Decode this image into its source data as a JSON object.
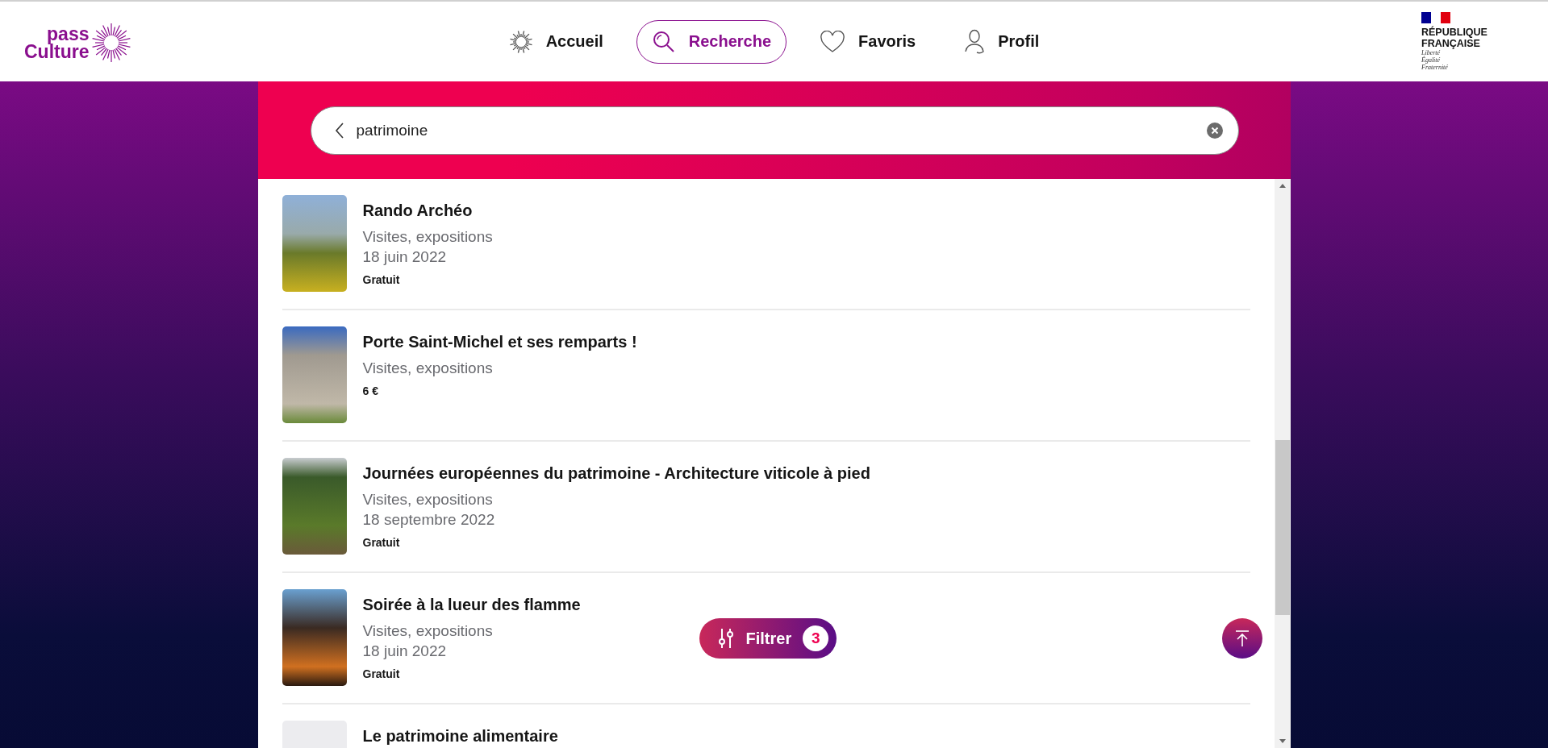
{
  "header": {
    "logo": {
      "line_1": "pass",
      "line_2": "Culture"
    },
    "nav": [
      {
        "label": "Accueil",
        "kind": "home",
        "selected": false
      },
      {
        "label": "Recherche",
        "kind": "search",
        "selected": true
      },
      {
        "label": "Favoris",
        "kind": "heart",
        "selected": false
      },
      {
        "label": "Profil",
        "kind": "profile",
        "selected": false
      }
    ],
    "republic": {
      "name_1": "RÉPUBLIQUE",
      "name_2": "FRANÇAISE",
      "motto": [
        "Liberté",
        "Égalité",
        "Fraternité"
      ]
    }
  },
  "search": {
    "value": "patrimoine"
  },
  "results": [
    {
      "title": "Rando Archéo",
      "category": "Visites, expositions",
      "date": "18 juin 2022",
      "price": "Gratuit"
    },
    {
      "title": "Porte Saint-Michel et ses remparts !",
      "category": "Visites, expositions",
      "price": "6 €"
    },
    {
      "title": "Journées européennes du patrimoine - Architecture viticole à pied",
      "category": "Visites, expositions",
      "date": "18 septembre 2022",
      "price": "Gratuit"
    },
    {
      "title": "Soirée à la lueur des flamme",
      "category": "Visites, expositions",
      "date": "18 juin 2022",
      "price": "Gratuit"
    },
    {
      "title": "Le patrimoine alimentaire"
    }
  ],
  "filter": {
    "label": "Filtrer",
    "count": "3"
  }
}
